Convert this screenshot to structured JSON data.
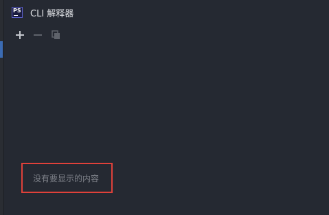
{
  "window": {
    "title": "CLI 解释器",
    "app_icon_text": "PS"
  },
  "toolbar": {
    "add_icon": "plus-icon",
    "remove_icon": "minus-icon",
    "copy_icon": "copy-icon"
  },
  "list": {
    "empty_text": "没有要显示的内容"
  },
  "colors": {
    "background": "#252932",
    "highlight_border": "#e0413a",
    "accent": "#3b6bb3"
  }
}
